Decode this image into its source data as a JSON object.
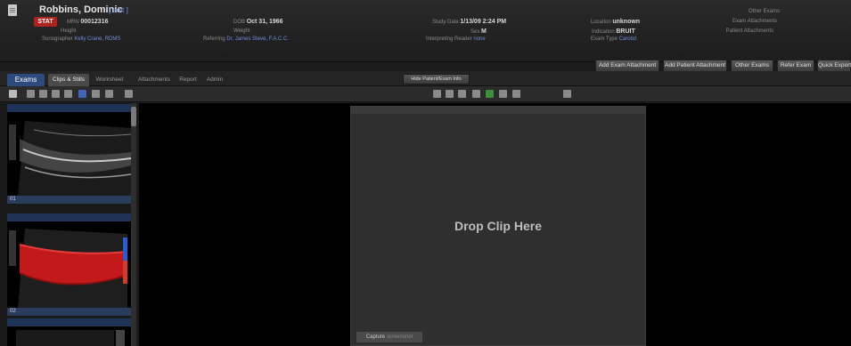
{
  "header": {
    "patient_name": "Robbins, Dominic",
    "edit_label": "[ edit ]",
    "stat_badge": "STAT",
    "mrn_label": "MRN",
    "mrn_value": "00012316",
    "height_label": "Height",
    "sonographer_label": "Sonographer",
    "sonographer_value": "Kelly Crane, RDMS",
    "dob_label": "DOB",
    "dob_value": "Oct 31, 1966",
    "weight_label": "Weight",
    "referring_label": "Referring",
    "referring_value": "Dr. James Steve, F.A.C.C.",
    "study_date_label": "Study Date",
    "study_date_value": "1/13/09 2:24 PM",
    "sex_label": "Sex",
    "sex_value": "M",
    "interpreting_label": "Interpreting Reader",
    "interpreting_value": "none",
    "location_label": "Location",
    "location_value": "unknown",
    "indication_label": "Indication",
    "indication_value": "BRUIT",
    "exam_type_label": "Exam Type",
    "exam_type_value": "Carotid",
    "other_exams_label": "Other Exams",
    "exam_attachments_label": "Exam Attachments",
    "patient_attachments_label": "Patient Attachments"
  },
  "actions": [
    "Add Exam Attachment",
    "Add Patient Attachment",
    "Other Exams",
    "Refer Exam",
    "Quick Export"
  ],
  "tabs": [
    "Exams",
    "Clips & Stills",
    "Worksheet",
    "Attachments",
    "Report",
    "Admin"
  ],
  "hide_info_button": "Hide Patient/Exam Info",
  "thumbnails": [
    {
      "label": "01"
    },
    {
      "label": "02"
    }
  ],
  "viewer": {
    "drop_text": "Drop Clip Here",
    "capture_label": "Capture",
    "capture_sub": "screenshot"
  },
  "colors": {
    "stat": "#b0231d",
    "tab_active": "#2e4a7c",
    "link": "#6f8fd8",
    "doppler_red": "#c21a1a"
  }
}
